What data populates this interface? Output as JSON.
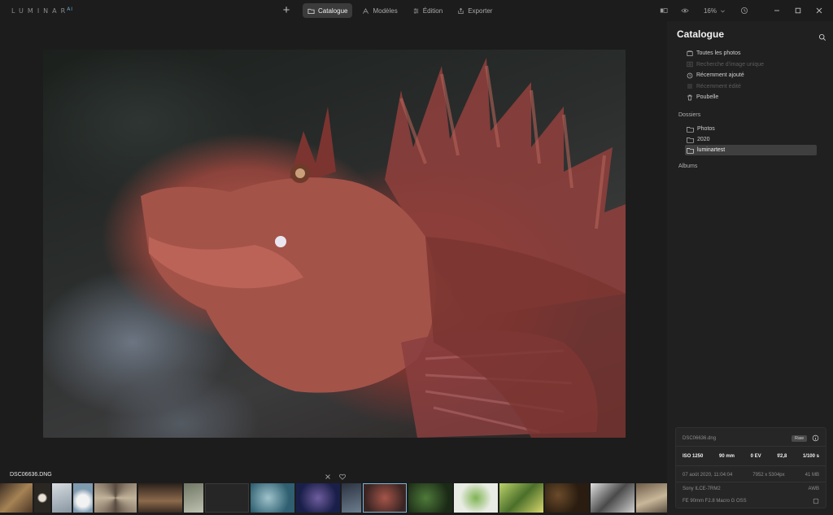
{
  "app": {
    "logo_text": "LUMINAR",
    "logo_suffix": "AI"
  },
  "topbar": {
    "tabs": [
      {
        "label": "Catalogue",
        "icon": "folder-icon",
        "active": true
      },
      {
        "label": "Modèles",
        "icon": "templates-icon",
        "active": false
      },
      {
        "label": "Édition",
        "icon": "edit-icon",
        "active": false
      },
      {
        "label": "Exporter",
        "icon": "export-icon",
        "active": false
      }
    ],
    "zoom": "16%"
  },
  "viewer": {
    "filename": "DSC06636.DNG"
  },
  "panel": {
    "title": "Catalogue",
    "catalog_items": [
      {
        "label": "Toutes les photos",
        "icon": "photos-icon",
        "enabled": true
      },
      {
        "label": "Recherche d'image unique",
        "icon": "search-image-icon",
        "enabled": false
      },
      {
        "label": "Récemment ajouté",
        "icon": "clock-icon",
        "enabled": true
      },
      {
        "label": "Récemment édité",
        "icon": "sliders-icon",
        "enabled": false
      },
      {
        "label": "Poubelle",
        "icon": "trash-icon",
        "enabled": true
      }
    ],
    "folders_label": "Dossiers",
    "folders": [
      {
        "label": "Photos",
        "active": false
      },
      {
        "label": "2020",
        "active": false
      },
      {
        "label": "luminartest",
        "active": true
      }
    ],
    "albums_label": "Albums"
  },
  "info": {
    "filename": "DSC06636.dng",
    "badge": "Raw",
    "iso": "ISO 1250",
    "focal": "90 mm",
    "ev": "0 EV",
    "aperture": "f/2,8",
    "shutter": "1/100 s",
    "date": "07 août 2020, 11:04:04",
    "dimensions": "7952 x 5304px",
    "size": "41 MB",
    "camera": "Sony ILCE-7RM2",
    "wb": "AWB",
    "lens": "FE 90mm F2.8 Macro G OSS"
  },
  "colors": {
    "accent": "#7bb4d8",
    "panel": "#202020",
    "background": "#1c1c1c"
  }
}
